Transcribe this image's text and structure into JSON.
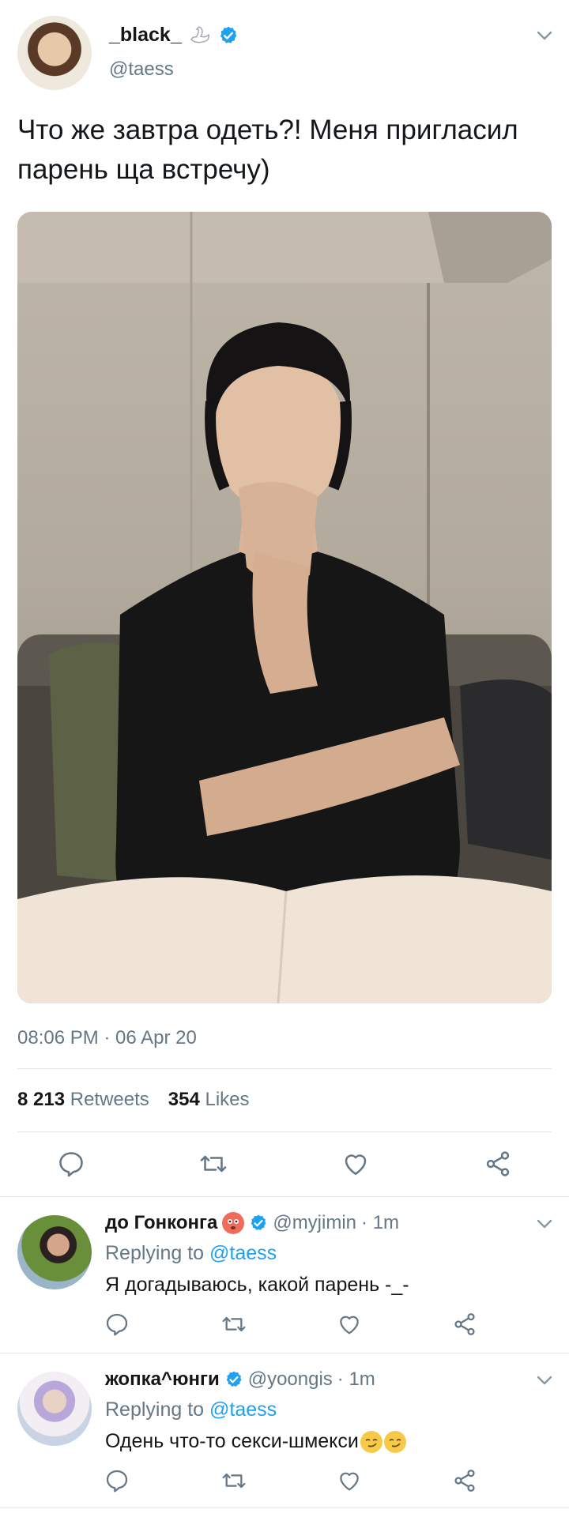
{
  "tweet": {
    "author_name": "_black_",
    "author_handle": "@taess",
    "text": "Что же завтра одеть?! Меня пригласил парень ща встречу)",
    "timestamp": "08:06 PM · 06 Apr 20",
    "retweets_count": "8 213",
    "retweets_label": "Retweets",
    "likes_count": "354",
    "likes_label": "Likes"
  },
  "replies": [
    {
      "name": "до Гонконга",
      "handle": "@myjimin",
      "time": "· 1m",
      "replying_prefix": "Replying to",
      "replying_to": "@taess",
      "text": "Я догадываюсь, какой парень  -_-"
    },
    {
      "name": "жопка^юнги",
      "handle": "@yoongis",
      "time": "· 1m",
      "replying_prefix": "Replying to",
      "replying_to": "@taess",
      "text": "Одень что-то секси-шмекси"
    }
  ],
  "colors": {
    "text": "#14171a",
    "secondary": "#657786",
    "accent": "#1da1f2",
    "divider": "#e1e8ed"
  },
  "icons": [
    "verified-badge",
    "chevron-down",
    "reply",
    "retweet",
    "like",
    "share",
    "swan-emoji",
    "flushed-face-emoji",
    "smirking-face-emoji"
  ]
}
